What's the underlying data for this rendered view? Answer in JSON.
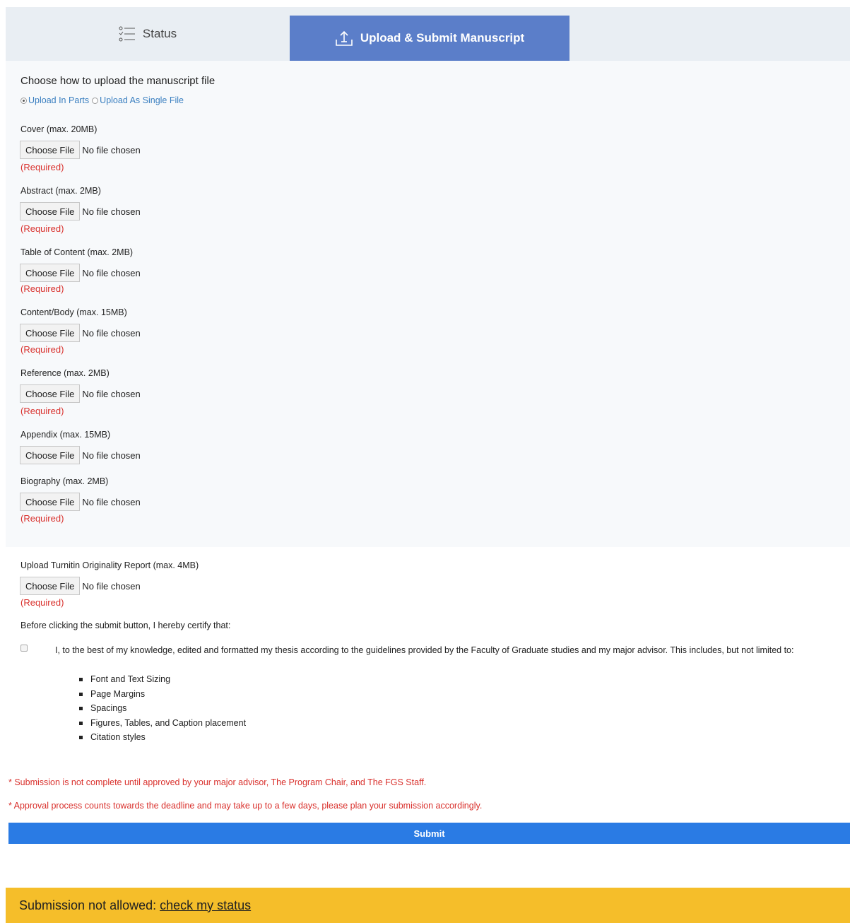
{
  "tabs": {
    "status_label": "Status",
    "upload_label": "Upload & Submit Manuscript"
  },
  "upload_choice": {
    "title": "Choose how to upload the manuscript file",
    "option_parts": "Upload In Parts",
    "option_single": "Upload As Single File",
    "selected": "Upload In Parts"
  },
  "file_button_label": "Choose File",
  "no_file_label": "No file chosen",
  "required_label": "(Required)",
  "fields": [
    {
      "label": "Cover (max. 20MB)",
      "required": true
    },
    {
      "label": "Abstract (max. 2MB)",
      "required": true
    },
    {
      "label": "Table of Content (max. 2MB)",
      "required": true
    },
    {
      "label": "Content/Body (max. 15MB)",
      "required": true
    },
    {
      "label": "Reference (max. 2MB)",
      "required": true
    },
    {
      "label": "Appendix (max. 15MB)",
      "required": false
    },
    {
      "label": "Biography (max. 2MB)",
      "required": true
    },
    {
      "label": "Upload Turnitin Originality Report (max. 4MB)",
      "required": true
    }
  ],
  "certify": {
    "title": "Before clicking the submit button, I hereby certify that:",
    "statement": "I, to the best of my knowledge, edited and formatted my thesis according to the guidelines provided by the Faculty of Graduate studies and my major advisor. This includes, but not limited to:",
    "items": [
      "Font and Text Sizing",
      "Page Margins",
      "Spacings",
      "Figures, Tables, and Caption placement",
      "Citation styles"
    ],
    "checked": false
  },
  "notes": [
    "* Submission is not complete until approved by your major advisor, The Program Chair, and The FGS Staff.",
    "* Approval process counts towards the deadline and may take up to a few days, please plan your submission accordingly."
  ],
  "submit_label": "Submit",
  "banner": {
    "text": "Submission not allowed:",
    "link": "check my status"
  },
  "colors": {
    "active_tab": "#5b7ec9",
    "submit": "#2a7be4",
    "banner": "#f5be2a",
    "required": "#d9302c",
    "radio_link": "#3a7fc0"
  }
}
